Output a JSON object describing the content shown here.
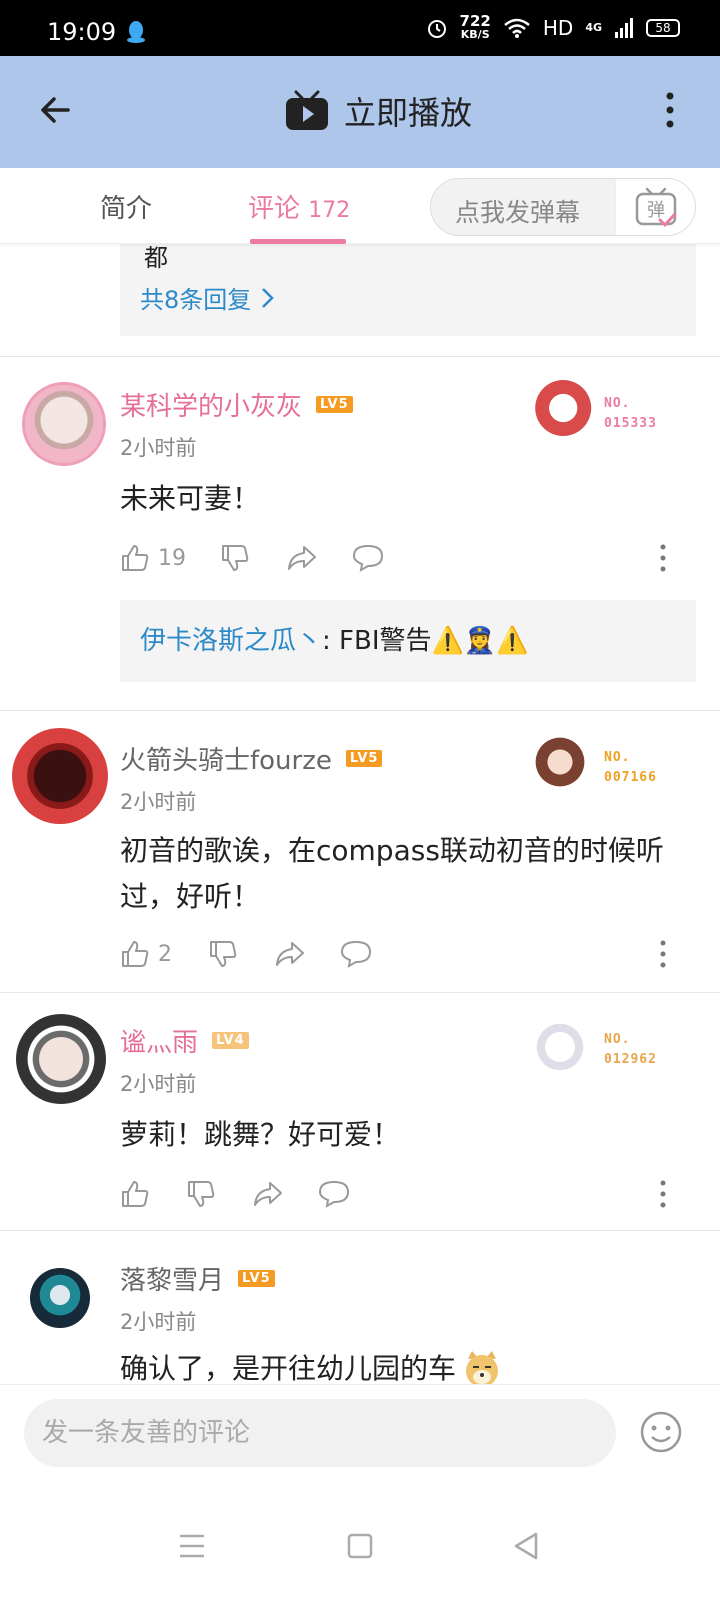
{
  "status_bar": {
    "time": "19:09",
    "net_speed_value": "722",
    "net_speed_unit": "KB/S",
    "hd": "HD",
    "network": "4G",
    "battery": "58"
  },
  "app_bar": {
    "title": "立即播放"
  },
  "tabs": {
    "intro": "简介",
    "comments": "评论",
    "comments_count": "172",
    "danmu_placeholder": "点我发弹幕",
    "danmu_icon_text": "弹"
  },
  "previous_reply": {
    "partial_text": "都",
    "more_replies": "共8条回复"
  },
  "comments": [
    {
      "username": "某科学的小灰灰",
      "level": "LV5",
      "time": "2小时前",
      "text": "未来可妻！",
      "likes": "19",
      "badge_label": "NO.",
      "badge_number": "015333",
      "reply_user": "伊卡洛斯之瓜丶",
      "reply_text": ": FBI警告⚠️👮‍♀️⚠️"
    },
    {
      "username": "火箭头骑士fourze",
      "level": "LV5",
      "time": "2小时前",
      "text": "初音的歌诶，在compass联动初音的时候听过，好听！",
      "likes": "2",
      "badge_label": "NO.",
      "badge_number": "007166"
    },
    {
      "username": "谧灬雨",
      "level": "LV4",
      "time": "2小时前",
      "text": "萝莉！跳舞？好可爱！",
      "likes": "",
      "badge_label": "NO.",
      "badge_number": "012962"
    },
    {
      "username": "落黎雪月",
      "level": "LV5",
      "time": "2小时前",
      "text": "确认了，是开往幼儿园的车"
    }
  ],
  "bottom": {
    "input_placeholder": "发一条友善的评论"
  },
  "colors": {
    "app_bar_bg": "#adc6ea",
    "accent_pink": "#ec7aa2",
    "link_blue": "#2d8ac9",
    "lv5_orange": "#f59a23",
    "lv4_orange": "#f7c27a"
  }
}
